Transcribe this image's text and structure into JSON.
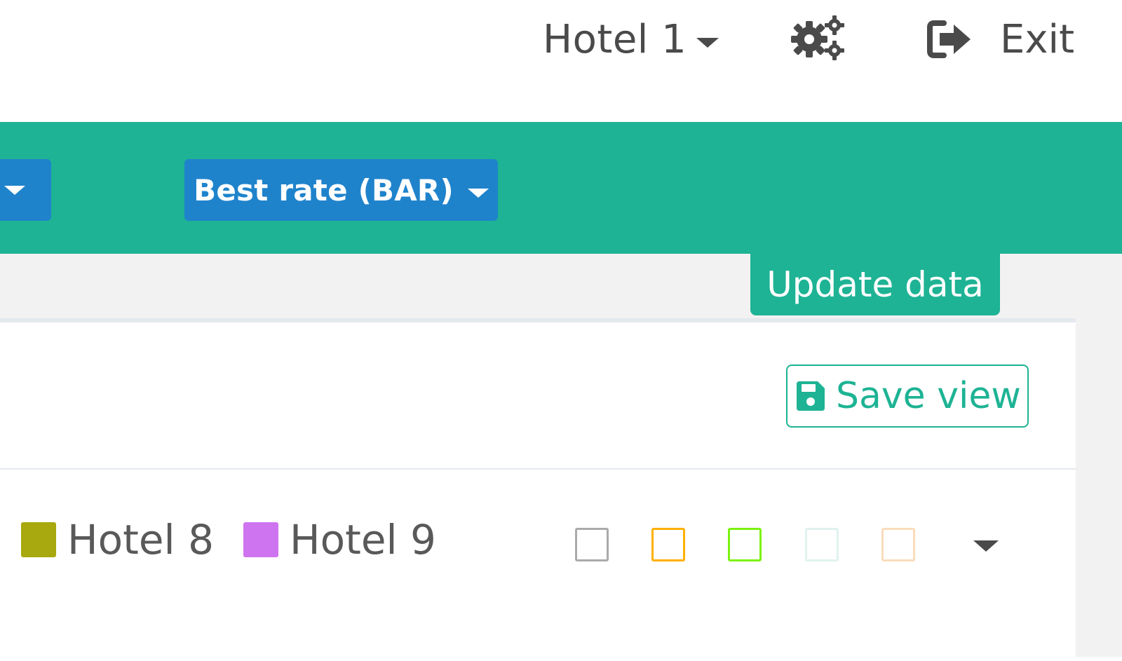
{
  "header": {
    "hotel_selector": {
      "label": "Hotel 1",
      "icon": "chevron-down-icon"
    },
    "settings": {
      "icon": "gears-icon"
    },
    "exit": {
      "label": "Exit",
      "icon": "sign-out-icon"
    }
  },
  "filters": {
    "rate_dropdown": {
      "label": "Best rate (BAR)"
    }
  },
  "actions": {
    "update_label": "Update data",
    "save_view_label": "Save view"
  },
  "legend": {
    "items": [
      {
        "label": "Hotel 8",
        "color": "#a8a80f"
      },
      {
        "label": "Hotel 9",
        "color": "#cf74f0"
      }
    ],
    "toggles": [
      {
        "color": "#aaaaaa"
      },
      {
        "color": "#ffb000"
      },
      {
        "color": "#7cf20d"
      },
      {
        "color": "#e0f2ef"
      },
      {
        "color": "#f9dcbc"
      }
    ]
  },
  "colors": {
    "brand_green": "#1db394",
    "button_blue": "#1f83cc",
    "text_dark": "#4a4a4a"
  }
}
